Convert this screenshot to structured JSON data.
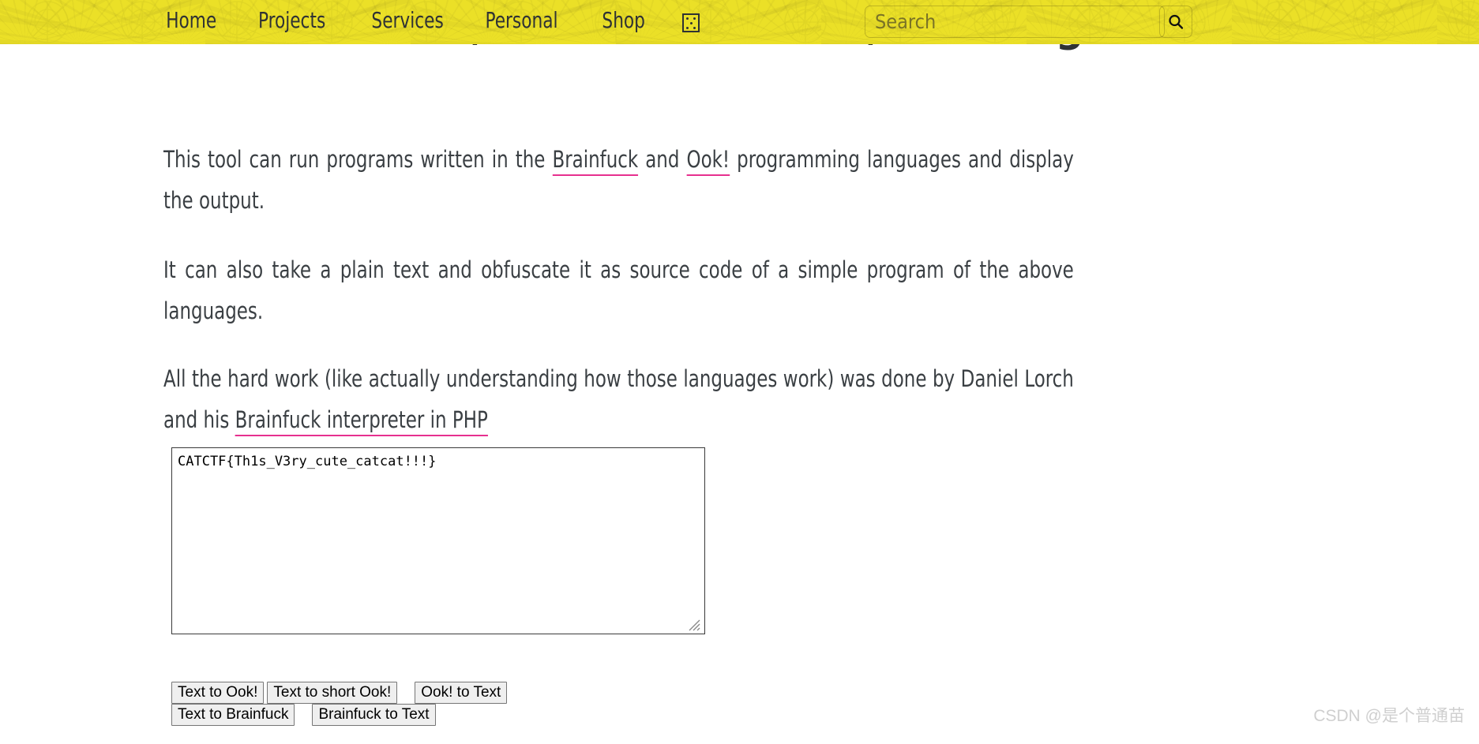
{
  "nav": {
    "items": [
      {
        "label": "Home"
      },
      {
        "label": "Projects"
      },
      {
        "label": "Services"
      },
      {
        "label": "Personal"
      },
      {
        "label": "Shop"
      }
    ],
    "grid_icon": "grid-dots-icon",
    "search": {
      "placeholder": "Search",
      "value": "",
      "button_icon": "search-icon"
    },
    "background_color": "#ebe027"
  },
  "page": {
    "title": "Brainfuck Ook/Ook! Obfuscation/Encoding",
    "paragraphs": {
      "p1_a": "This tool can run programs written in the ",
      "p1_link1": "Brainfuck",
      "p1_b": " and ",
      "p1_link2": "Ook!",
      "p1_c": " programming languages and display the output.",
      "p2": "It can also take a plain text and obfuscate it as source code of a simple program of the above languages.",
      "p3_a": "All the hard work (like actually understanding how those languages work) was done by Daniel Lorch and his ",
      "p3_link": "Brainfuck interpreter in PHP"
    },
    "link_underline_color": "#e6308f"
  },
  "editor": {
    "textarea_value": "CATCTF{Th1s_V3ry_cute_catcat!!!}",
    "textarea_placeholder": "",
    "resize_handle": "resize-grip-icon"
  },
  "buttons": {
    "row1": [
      {
        "label": "Text to Ook!"
      },
      {
        "label": "Text to short Ook!"
      },
      {
        "label": "Ook! to Text"
      }
    ],
    "row2": [
      {
        "label": "Text to Brainfuck"
      },
      {
        "label": "Brainfuck to Text"
      }
    ]
  },
  "watermark": {
    "text": "CSDN @是个普通苗"
  }
}
